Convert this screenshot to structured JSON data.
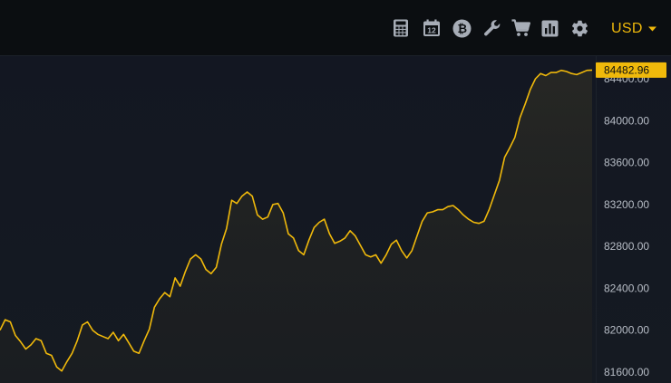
{
  "toolbar": {
    "icons": [
      "calculator-icon",
      "calendar-icon",
      "bitcoin-icon",
      "wrench-icon",
      "cart-icon",
      "bar-chart-icon",
      "gear-icon"
    ],
    "calendar_day": "12",
    "currency": "USD"
  },
  "colors": {
    "accent": "#f0b90b",
    "background": "#12161c",
    "topbar": "#0b0e11",
    "axis_text": "#b7bdc6"
  },
  "chart_data": {
    "type": "area",
    "title": "",
    "xlabel": "",
    "ylabel": "",
    "ylim": [
      81550,
      84700
    ],
    "y_ticks": [
      "81600.00",
      "82000.00",
      "82400.00",
      "82800.00",
      "83200.00",
      "83600.00",
      "84000.00",
      "84400.00"
    ],
    "last_price": "84482.96",
    "series": [
      {
        "values": [
          82000,
          82100,
          82080,
          81950,
          81890,
          81820,
          81860,
          81920,
          81900,
          81780,
          81760,
          81650,
          81610,
          81700,
          81780,
          81900,
          82050,
          82080,
          82000,
          81960,
          81940,
          81920,
          81980,
          81900,
          81960,
          81880,
          81800,
          81780,
          81900,
          82010,
          82220,
          82300,
          82360,
          82320,
          82500,
          82420,
          82560,
          82680,
          82720,
          82680,
          82580,
          82540,
          82600,
          82820,
          82970,
          83240,
          83210,
          83280,
          83320,
          83280,
          83100,
          83060,
          83080,
          83200,
          83210,
          83120,
          82920,
          82880,
          82760,
          82720,
          82860,
          82980,
          83030,
          83060,
          82920,
          82830,
          82850,
          82880,
          82950,
          82900,
          82810,
          82720,
          82700,
          82720,
          82640,
          82720,
          82820,
          82860,
          82760,
          82690,
          82760,
          82900,
          83040,
          83120,
          83130,
          83150,
          83150,
          83180,
          83190,
          83150,
          83100,
          83060,
          83030,
          83020,
          83040,
          83150,
          83290,
          83430,
          83650,
          83740,
          83840,
          84030,
          84160,
          84300,
          84400,
          84450,
          84430,
          84460,
          84460,
          84480,
          84470,
          84450,
          84440,
          84460,
          84480,
          84483
        ]
      }
    ]
  }
}
